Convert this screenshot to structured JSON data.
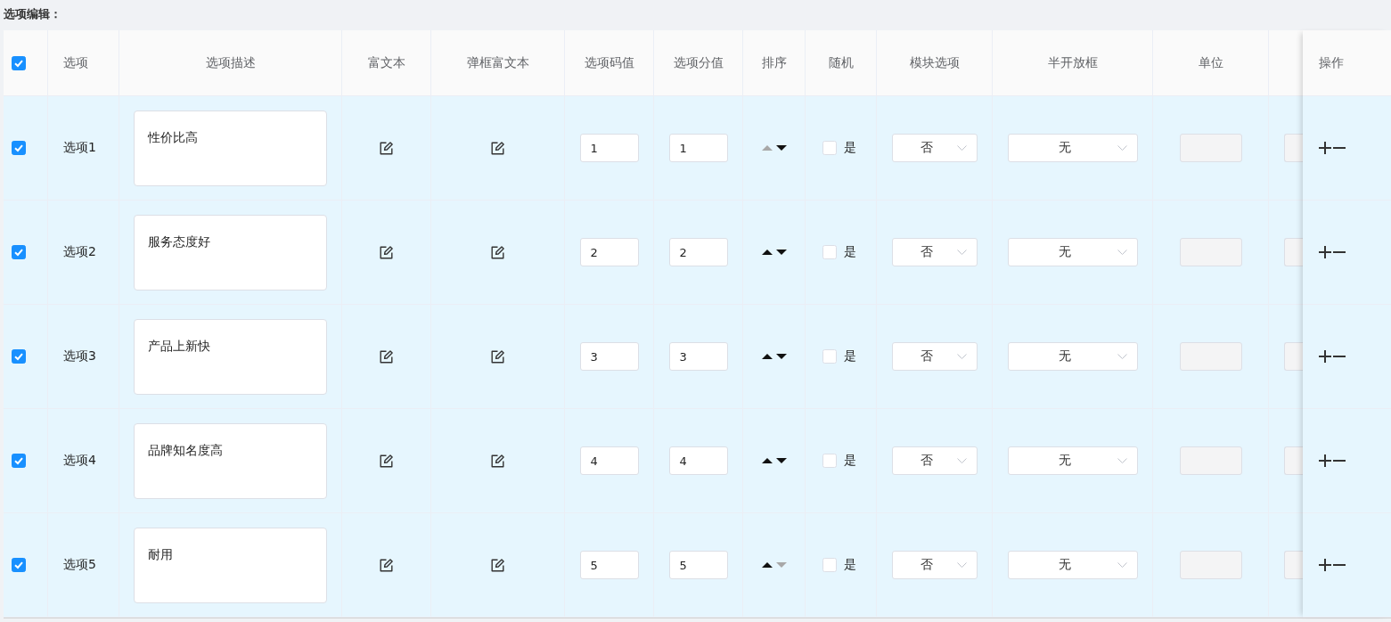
{
  "section_title": "选项编辑：",
  "table": {
    "header_checkbox": {
      "checked": true
    },
    "columns": [
      "选项",
      "选项描述",
      "富文本",
      "弹框富文本",
      "选项码值",
      "选项分值",
      "排序",
      "随机",
      "模块选项",
      "半开放框",
      "单位"
    ],
    "fixed_column": {
      "header": "操作"
    },
    "rows": [
      {
        "checked": true,
        "label": "选项1",
        "description": "性价比高",
        "code": "1",
        "score": "1",
        "sort_up_disabled": true,
        "sort_down_disabled": false,
        "random": {
          "label": "是",
          "checked": false
        },
        "module_option": "否",
        "half_open": "无",
        "unit_disabled": true,
        "column_13_disabled": true
      },
      {
        "checked": true,
        "label": "选项2",
        "description": "服务态度好",
        "code": "2",
        "score": "2",
        "sort_up_disabled": false,
        "sort_down_disabled": false,
        "random": {
          "label": "是",
          "checked": false
        },
        "module_option": "否",
        "half_open": "无",
        "unit_disabled": true,
        "column_13_disabled": true
      },
      {
        "checked": true,
        "label": "选项3",
        "description": "产品上新快",
        "code": "3",
        "score": "3",
        "sort_up_disabled": false,
        "sort_down_disabled": false,
        "random": {
          "label": "是",
          "checked": false
        },
        "module_option": "否",
        "half_open": "无",
        "unit_disabled": true,
        "column_13_disabled": true
      },
      {
        "checked": true,
        "label": "选项4",
        "description": "品牌知名度高",
        "code": "4",
        "score": "4",
        "sort_up_disabled": false,
        "sort_down_disabled": false,
        "random": {
          "label": "是",
          "checked": false
        },
        "module_option": "否",
        "half_open": "无",
        "unit_disabled": true,
        "column_13_disabled": true
      },
      {
        "checked": true,
        "label": "选项5",
        "description": "耐用",
        "code": "5",
        "score": "5",
        "sort_up_disabled": false,
        "sort_down_disabled": true,
        "random": {
          "label": "是",
          "checked": false
        },
        "module_option": "否",
        "half_open": "无",
        "unit_disabled": true,
        "column_13_disabled": true
      }
    ]
  }
}
